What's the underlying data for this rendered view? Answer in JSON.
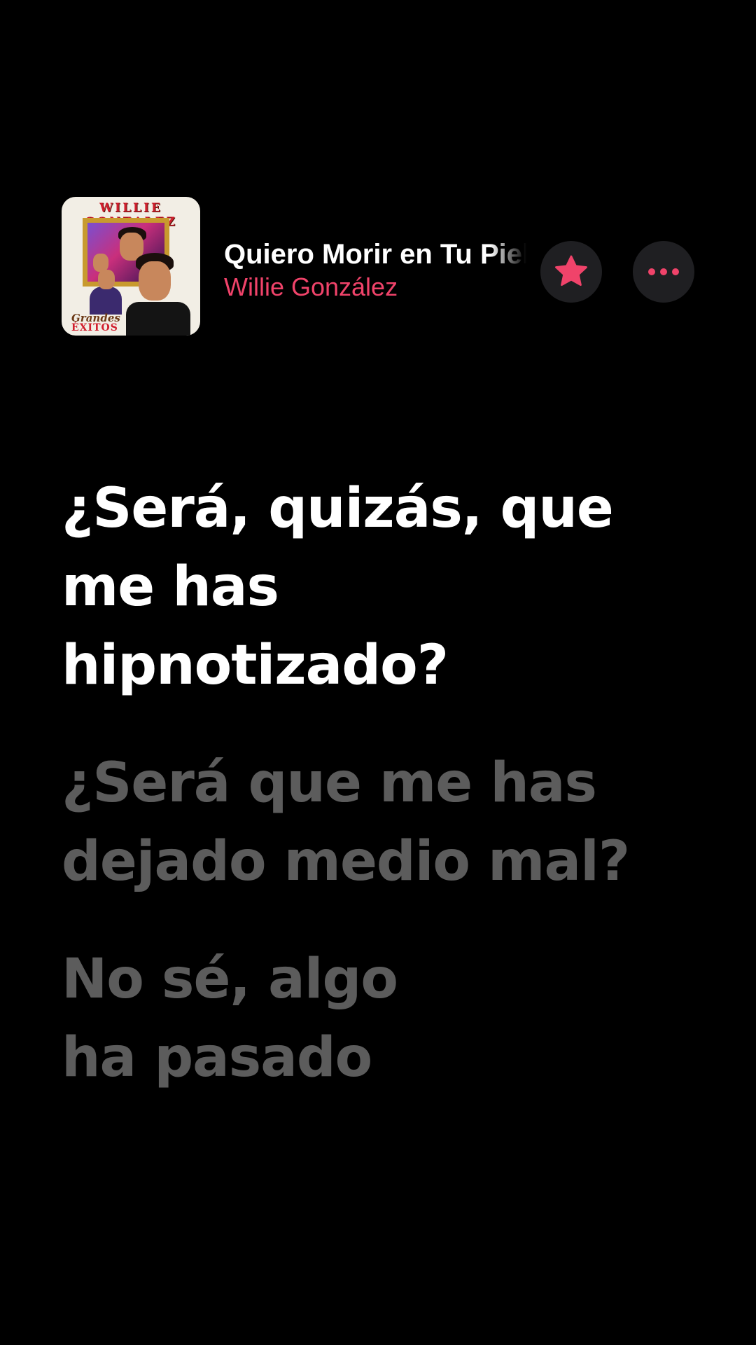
{
  "now_playing": {
    "title": "Quiero Morir en Tu Piel",
    "artist": "Willie González",
    "artwork": {
      "top_text": "WILLIE GONZALEZ",
      "subtitle_line1": "Grandes",
      "subtitle_line2": "ÉXITOS"
    },
    "favorite_icon": "star-icon",
    "more_icon": "ellipsis-icon"
  },
  "lyrics": [
    {
      "text": "¿Será, quizás, que\nme has\nhipnotizado?",
      "state": "active"
    },
    {
      "text": "¿Será que me has\ndejado medio mal?",
      "state": "inactive"
    },
    {
      "text": "No sé, algo\nha pasado",
      "state": "inactive"
    }
  ],
  "colors": {
    "background": "#000000",
    "accent": "#f0436a",
    "button_bg": "#1f1f22",
    "active_lyric": "#ffffff",
    "inactive_lyric": "rgba(255,255,255,0.36)"
  }
}
